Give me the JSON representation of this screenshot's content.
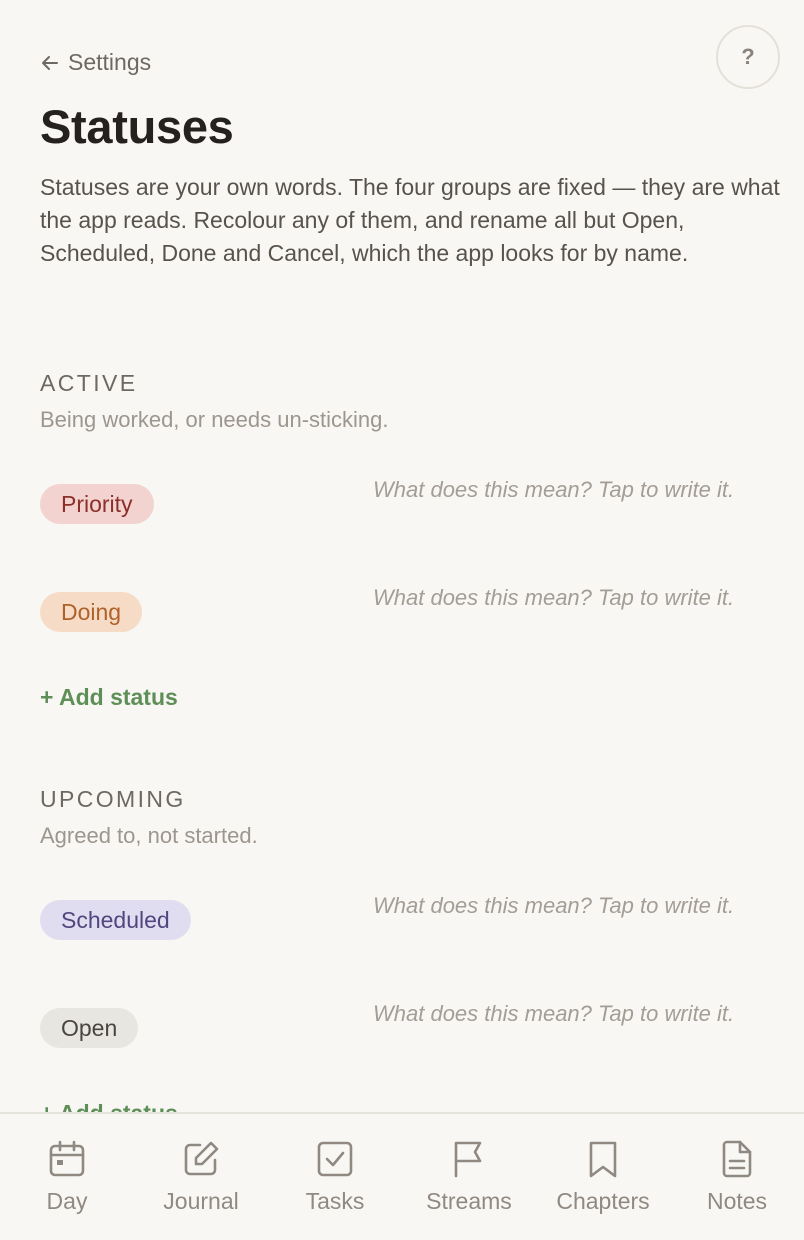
{
  "header": {
    "back_label": "Settings",
    "help_label": "?",
    "title": "Statuses",
    "intro": "Statuses are your own words. The four groups are fixed — they are what the app reads. Recolour any of them, and rename all but Open, Scheduled, Done and Cancel, which the app looks for by name."
  },
  "groups": [
    {
      "heading": "ACTIVE",
      "subtitle": "Being worked, or needs un-sticking.",
      "statuses": [
        {
          "label": "Priority",
          "bg": "#f2d3d0",
          "fg": "#8d2f2a",
          "description_placeholder": "What does this mean? Tap to write it."
        },
        {
          "label": "Doing",
          "bg": "#f6dcc6",
          "fg": "#b0612a",
          "description_placeholder": "What does this mean? Tap to write it."
        }
      ],
      "add_label": "+ Add status"
    },
    {
      "heading": "UPCOMING",
      "subtitle": "Agreed to, not started.",
      "statuses": [
        {
          "label": "Scheduled",
          "bg": "#e1ddf1",
          "fg": "#52467e",
          "description_placeholder": "What does this mean? Tap to write it."
        },
        {
          "label": "Open",
          "bg": "#e8e6e1",
          "fg": "#4a4540",
          "description_placeholder": "What does this mean? Tap to write it."
        }
      ],
      "add_label": "+ Add status"
    }
  ],
  "tabbar": {
    "items": [
      {
        "label": "Day",
        "icon": "calendar-icon"
      },
      {
        "label": "Journal",
        "icon": "pencil-square-icon"
      },
      {
        "label": "Tasks",
        "icon": "checkbox-icon"
      },
      {
        "label": "Streams",
        "icon": "flag-icon"
      },
      {
        "label": "Chapters",
        "icon": "bookmark-icon"
      },
      {
        "label": "Notes",
        "icon": "document-icon"
      }
    ]
  },
  "colors": {
    "background": "#f9f7f3",
    "accent_green": "#5f8f59",
    "muted_text": "#a39d96"
  }
}
